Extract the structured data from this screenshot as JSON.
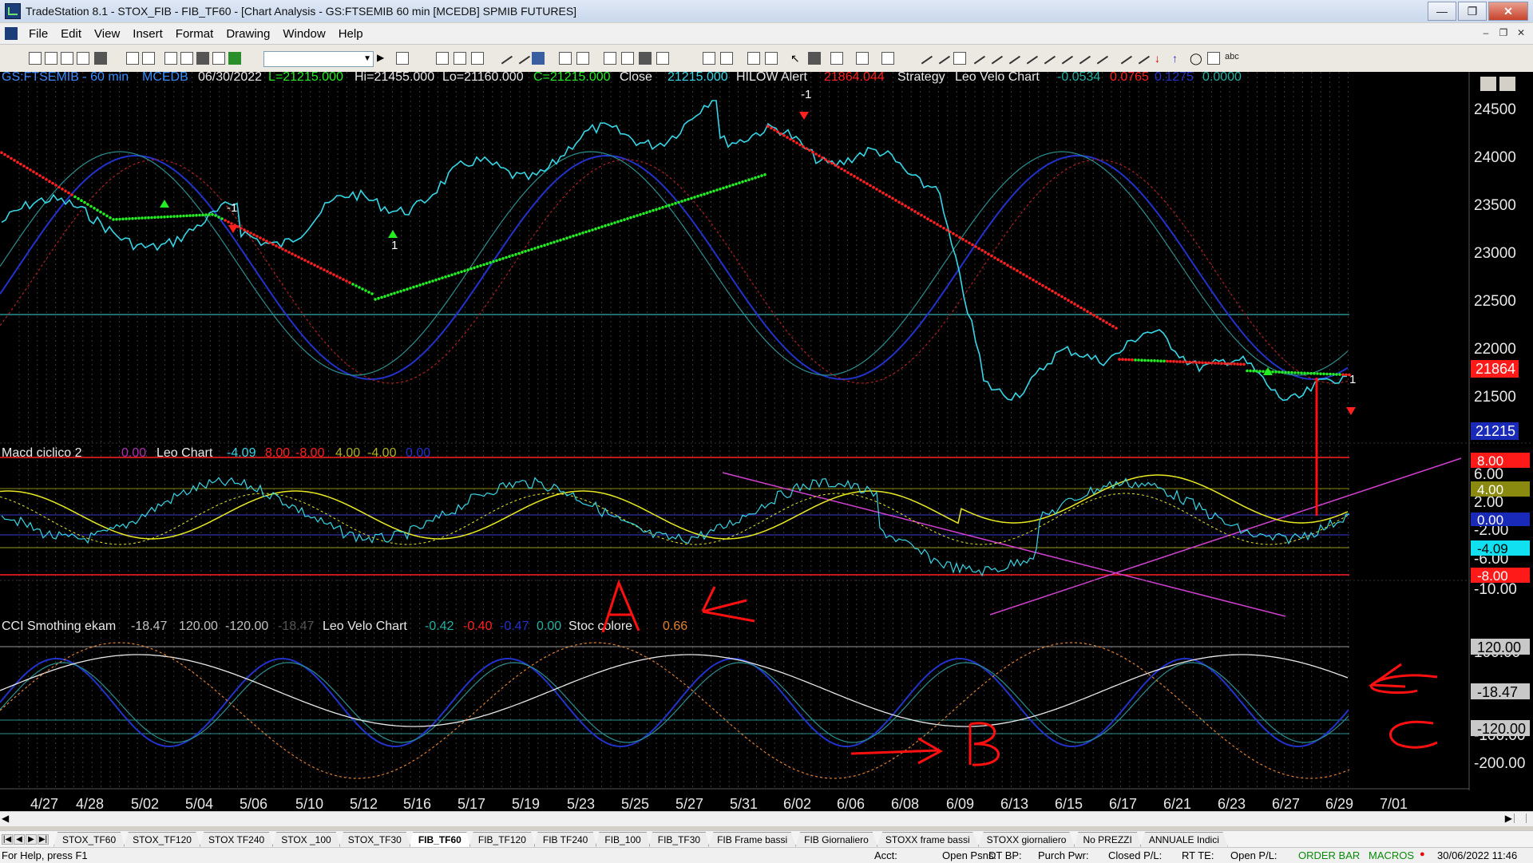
{
  "window": {
    "title": "TradeStation 8.1 - STOX_FIB - FIB_TF60 - [Chart Analysis - GS:FTSEMIB  60 min  [MCEDB] SPMIB FUTURES]",
    "minimize": "—",
    "restore": "❐",
    "close": "✕"
  },
  "menu": {
    "items": [
      "File",
      "Edit",
      "View",
      "Insert",
      "Format",
      "Drawing",
      "Window",
      "Help"
    ],
    "mdi_minimize": "–",
    "mdi_restore": "❐",
    "mdi_close": "✕"
  },
  "toolbar": {
    "symbol_combo_value": "",
    "text_tool_label": "abc"
  },
  "price_panel": {
    "header": {
      "symbol": "GS:FTSEMIB - 60 min",
      "dataset": "MCEDB",
      "date": "06/30/2022",
      "last": "L=21215.000",
      "high": "Hi=21455.000",
      "low": "Lo=21160.000",
      "close": "C=21215.000",
      "close_label": "Close",
      "close_value": "21215.000",
      "alert_label": "HILOW Alert",
      "alert_value": "21864.044",
      "strategy_label": "Strategy",
      "velo_label": "Leo Velo Chart",
      "velo_v1": "-0.0534",
      "velo_v2": "0.0765",
      "velo_v3": "0.1275",
      "velo_v4": "0.0000"
    },
    "y_ticks": [
      "24500",
      "24000",
      "23500",
      "23000",
      "22500",
      "22000",
      "21500"
    ],
    "markers": {
      "line_value": "21864",
      "last_value": "21215"
    },
    "annotations": [
      "-1",
      "-1",
      "1",
      "-1",
      "1",
      "1"
    ]
  },
  "macd_panel": {
    "header": {
      "name": "Macd ciclico 2",
      "v0": "0.00",
      "leo_label": "Leo Chart",
      "v1": "-4.09",
      "v2": "8.00",
      "v3": "-8.00",
      "v4": "4.00",
      "v5": "-4.00",
      "v6": "0.00"
    },
    "y_ticks": [
      "6.00",
      "2.00",
      "-2.00",
      "-6.00",
      "-10.00"
    ],
    "markers": {
      "upper": "8.00",
      "mid_upper": "4.00",
      "zero": "0.00",
      "last": "-4.09",
      "lower": "-8.00"
    }
  },
  "cci_panel": {
    "header": {
      "name": "CCI Smothing ekam",
      "v1": "-18.47",
      "v2": "120.00",
      "v3": "-120.00",
      "v4": "-18.47",
      "velo_label": "Leo Velo Chart",
      "v5": "-0.42",
      "v6": "-0.40",
      "v7": "-0.47",
      "v8": "0.00",
      "stoc_label": "Stoc colore",
      "stoc_value": "0.66"
    },
    "y_ticks": [
      "100.00",
      "0.00",
      "-100.00",
      "-200.00"
    ],
    "markers": {
      "upper": "120.00",
      "last": "-18.47",
      "lower": "-120.00"
    }
  },
  "handwriting": {
    "letter_a": "A",
    "letter_b": "B",
    "letter_c": "C"
  },
  "x_axis": [
    "4/27",
    "4/28",
    "5/02",
    "5/04",
    "5/06",
    "5/10",
    "5/12",
    "5/16",
    "5/17",
    "5/19",
    "5/23",
    "5/25",
    "5/27",
    "5/31",
    "6/02",
    "6/06",
    "6/08",
    "6/09",
    "6/13",
    "6/15",
    "6/17",
    "6/21",
    "6/23",
    "6/27",
    "6/29",
    "7/01"
  ],
  "sheet_tabs": [
    "STOX_TF60",
    "STOX_TF120",
    "STOX TF240",
    "STOX _100",
    "STOX_TF30",
    "FIB_TF60",
    "FIB_TF120",
    "FIB TF240",
    "FIB_100",
    "FIB_TF30",
    "FIB Frame bassi",
    "FIB Giornaliero",
    "STOXX frame bassi",
    "STOXX giornaliero",
    "No PREZZI",
    "ANNUALE Indici"
  ],
  "active_tab": "FIB_TF60",
  "status": {
    "help": "For Help, press F1",
    "acct": "Acct:",
    "open_psns": "Open Psns:",
    "dt_bp": "DT BP:",
    "purch_pwr": "Purch Pwr:",
    "closed_pl": "Closed P/L:",
    "rt_te": "RT TE:",
    "open_pl": "Open P/L:",
    "order_bar": "ORDER BAR",
    "macros": "MACROS",
    "indicator": "●",
    "datetime": "30/06/2022 11:46"
  },
  "colors": {
    "background": "#000000",
    "ma_down": "#ff2020",
    "ma_up": "#22ee22",
    "price": "#35d6e6",
    "cycle_blue": "#2233cc",
    "macd_yellow": "#e8e820",
    "trend_magenta": "#d040d0",
    "handwriting_red": "#ff1010"
  }
}
